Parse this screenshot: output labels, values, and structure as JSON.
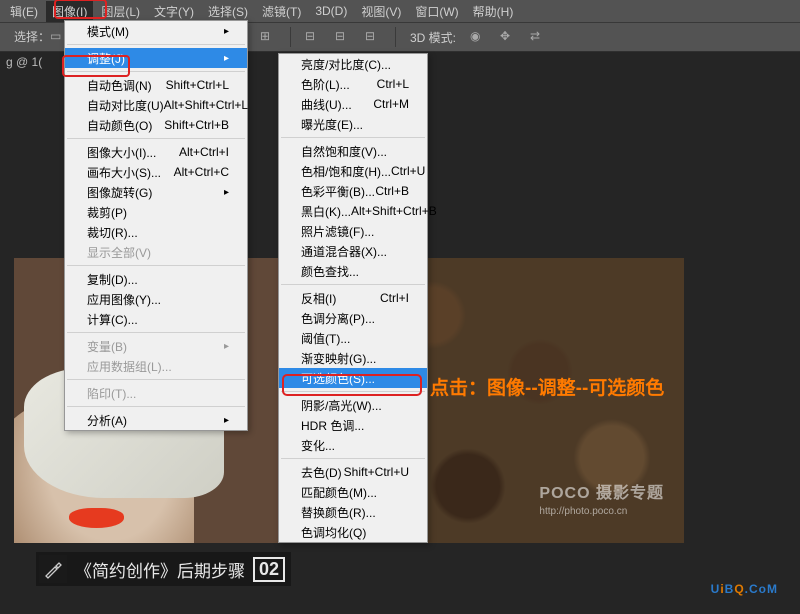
{
  "menubar": {
    "items": [
      "辑(E)",
      "图像(I)",
      "图层(L)",
      "文字(Y)",
      "选择(S)",
      "滤镜(T)",
      "3D(D)",
      "视图(V)",
      "窗口(W)",
      "帮助(H)"
    ]
  },
  "toolbar": {
    "selection_label": "选择：",
    "mode3d_label": "3D 模式:"
  },
  "doc_tab": "g @ 1(",
  "dropdown_image": {
    "mode": {
      "label": "模式(M)"
    },
    "adjust": {
      "label": "调整(J)"
    },
    "auto_tone": {
      "label": "自动色调(N)",
      "shortcut": "Shift+Ctrl+L"
    },
    "auto_contrast": {
      "label": "自动对比度(U)",
      "shortcut": "Alt+Shift+Ctrl+L"
    },
    "auto_color": {
      "label": "自动颜色(O)",
      "shortcut": "Shift+Ctrl+B"
    },
    "image_size": {
      "label": "图像大小(I)...",
      "shortcut": "Alt+Ctrl+I"
    },
    "canvas_size": {
      "label": "画布大小(S)...",
      "shortcut": "Alt+Ctrl+C"
    },
    "image_rotation": {
      "label": "图像旋转(G)"
    },
    "crop": {
      "label": "裁剪(P)"
    },
    "trim": {
      "label": "裁切(R)..."
    },
    "reveal_all": {
      "label": "显示全部(V)"
    },
    "duplicate": {
      "label": "复制(D)..."
    },
    "apply_image": {
      "label": "应用图像(Y)..."
    },
    "calculations": {
      "label": "计算(C)..."
    },
    "variables": {
      "label": "变量(B)"
    },
    "apply_dataset": {
      "label": "应用数据组(L)..."
    },
    "trap": {
      "label": "陷印(T)..."
    },
    "analysis": {
      "label": "分析(A)"
    }
  },
  "dropdown_adjust": {
    "brightness": {
      "label": "亮度/对比度(C)..."
    },
    "levels": {
      "label": "色阶(L)...",
      "shortcut": "Ctrl+L"
    },
    "curves": {
      "label": "曲线(U)...",
      "shortcut": "Ctrl+M"
    },
    "exposure": {
      "label": "曝光度(E)..."
    },
    "vibrance": {
      "label": "自然饱和度(V)..."
    },
    "hue_sat": {
      "label": "色相/饱和度(H)...",
      "shortcut": "Ctrl+U"
    },
    "color_balance": {
      "label": "色彩平衡(B)...",
      "shortcut": "Ctrl+B"
    },
    "bw": {
      "label": "黑白(K)...",
      "shortcut": "Alt+Shift+Ctrl+B"
    },
    "photo_filter": {
      "label": "照片滤镜(F)..."
    },
    "channel_mixer": {
      "label": "通道混合器(X)..."
    },
    "color_lookup": {
      "label": "颜色查找..."
    },
    "invert": {
      "label": "反相(I)",
      "shortcut": "Ctrl+I"
    },
    "posterize": {
      "label": "色调分离(P)..."
    },
    "threshold": {
      "label": "阈值(T)..."
    },
    "gradient_map": {
      "label": "渐变映射(G)..."
    },
    "selective_color": {
      "label": "可选颜色(S)..."
    },
    "shadows_hl": {
      "label": "阴影/高光(W)..."
    },
    "hdr_toning": {
      "label": "HDR 色调..."
    },
    "variations": {
      "label": "变化..."
    },
    "desaturate": {
      "label": "去色(D)",
      "shortcut": "Shift+Ctrl+U"
    },
    "match_color": {
      "label": "匹配颜色(M)..."
    },
    "replace_color": {
      "label": "替换颜色(R)..."
    },
    "equalize": {
      "label": "色调均化(Q)"
    }
  },
  "annotation": "点击：图像--调整--可选颜色",
  "watermark": {
    "line1": "POCO 摄影专题",
    "line2": "http://photo.poco.cn"
  },
  "footer": {
    "text": "《简约创作》后期步骤",
    "num": "02"
  },
  "brand": {
    "u": "U",
    "i": "i",
    "b": "B",
    "q": "Q",
    "rest": ".CoM"
  }
}
